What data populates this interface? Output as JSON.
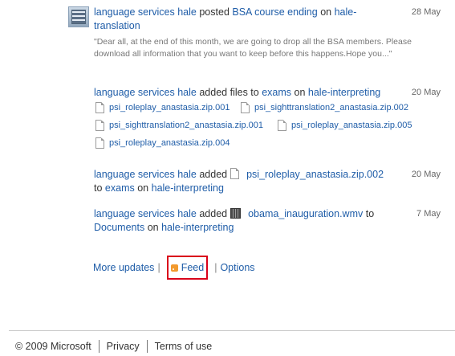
{
  "feed": {
    "item1": {
      "actor": "language services hale",
      "verb": "posted",
      "object": "BSA course ending",
      "on": "on",
      "target": "hale-translation",
      "date": "28 May",
      "quote": "\"Dear all, at the end of this month, we are going to drop all the BSA members. Please download all information that you want to keep before this happens.Hope you...\""
    },
    "item2": {
      "actor": "language services hale",
      "verb": "added files to",
      "folder": "exams",
      "on": "on",
      "target": "hale-interpreting",
      "date": "20 May",
      "files": [
        "psi_roleplay_anastasia.zip.001",
        "psi_sighttranslation2_anastasia.zip.002",
        "psi_sighttranslation2_anastasia.zip.001",
        "psi_roleplay_anastasia.zip.005",
        "psi_roleplay_anastasia.zip.004"
      ]
    },
    "item3": {
      "actor": "language services hale",
      "verb": "added",
      "file": "psi_roleplay_anastasia.zip.002",
      "to": "to",
      "folder": "exams",
      "on": "on",
      "target": "hale-interpreting",
      "date": "20 May"
    },
    "item4": {
      "actor": "language services hale",
      "verb": "added",
      "file": "obama_inauguration.wmv",
      "to": "to",
      "folder": "Documents",
      "on": "on",
      "target": "hale-interpreting",
      "date": "7 May"
    }
  },
  "links": {
    "more_updates": "More updates",
    "feed": "Feed",
    "options": "Options",
    "separator": "|"
  },
  "footer": {
    "copyright": "© 2009 Microsoft",
    "privacy": "Privacy",
    "terms": "Terms of use"
  }
}
